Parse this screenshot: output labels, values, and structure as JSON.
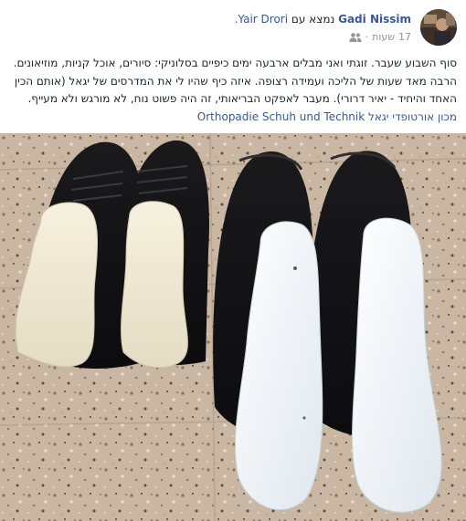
{
  "post": {
    "author": "Gadi Nissim",
    "with_text": "נמצא עם",
    "tagged_user": "Yair Drori.",
    "time_number": "17",
    "time_unit": "שעות",
    "audience_icon": "friends-icon",
    "body_text": "סוף השבוע שעבר. זוגתי ואני מבלים ארבעה ימים כיפיים בסלוניקי: סיורים, אוכל קניות, מוזיאונים. הרבה מאד שעות של הליכה ועמידה רצופה. איזה כיף שהיו לי את המדרסים של יגאל (אותם הכין האחד והיחיד - יאיר דרורי). מעבר לאפקט הבריאותי, זה היה פשוט נוח, לא מורגש ולא מעייף.",
    "tagged_page_hebrew": "מכון אורטופדי יגאל",
    "tagged_page_german": "Orthopadie Schuh und Technik",
    "photo_description_icon": "shoes-with-insoles-photo",
    "colors": {
      "link": "#365899",
      "text": "#1d2129",
      "meta": "#90949c"
    }
  }
}
